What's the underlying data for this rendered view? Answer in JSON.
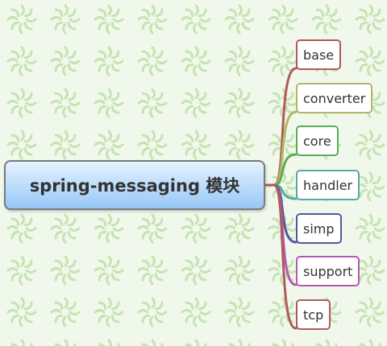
{
  "root": {
    "label": "spring-messaging 模块",
    "fill_top": "#e5f3ff",
    "fill_bottom": "#98c7f7",
    "border": "#7a7a7a"
  },
  "branches": [
    {
      "label": "base",
      "color": "#b05a5a"
    },
    {
      "label": "converter",
      "color": "#b5b566"
    },
    {
      "label": "core",
      "color": "#5aab5a"
    },
    {
      "label": "handler",
      "color": "#5aa8a4"
    },
    {
      "label": "simp",
      "color": "#55579e"
    },
    {
      "label": "support",
      "color": "#b05ab5"
    },
    {
      "label": "tcp",
      "color": "#b05a5a"
    }
  ],
  "background": {
    "base": "#f0f8ec",
    "pattern": "#bfe0a8"
  }
}
